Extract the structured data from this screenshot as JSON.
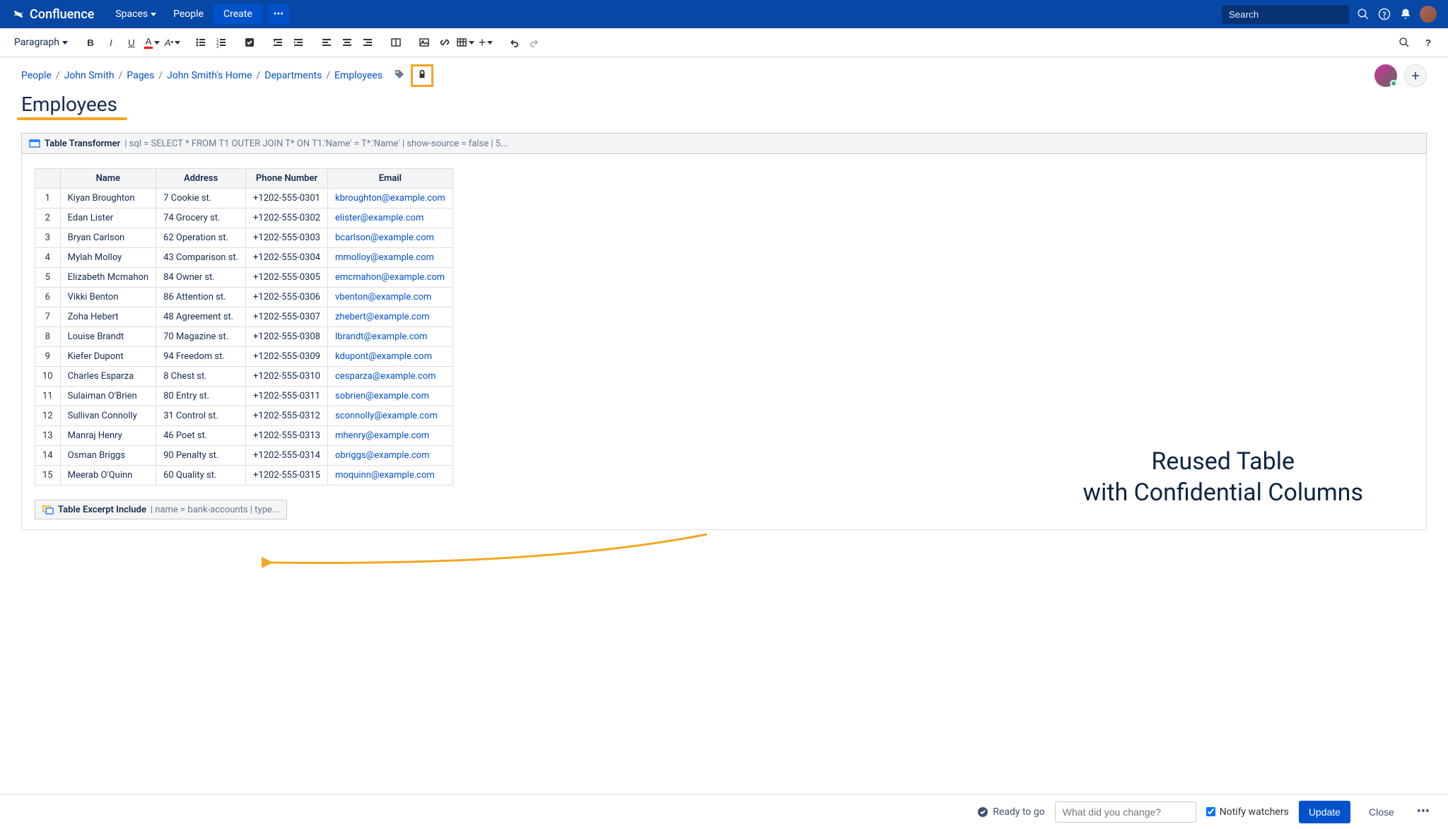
{
  "nav": {
    "product": "Confluence",
    "spaces": "Spaces",
    "people": "People",
    "create": "Create",
    "search_placeholder": "Search"
  },
  "toolbar": {
    "paragraph": "Paragraph"
  },
  "breadcrumb": [
    "People",
    "John Smith",
    "Pages",
    "John Smith's Home",
    "Departments",
    "Employees"
  ],
  "page_title": "Employees",
  "macro": {
    "name": "Table Transformer",
    "params": "sql = SELECT * FROM T1 OUTER JOIN T* ON T1.'Name' = T*.'Name' | show-source = false | 5..."
  },
  "table": {
    "columns": [
      "Name",
      "Address",
      "Phone Number",
      "Email"
    ],
    "rows": [
      {
        "idx": 1,
        "name": "Kiyan Broughton",
        "address": "7 Cookie st.",
        "phone": "+1202-555-0301",
        "email": "kbroughton@example.com"
      },
      {
        "idx": 2,
        "name": "Edan Lister",
        "address": "74 Grocery st.",
        "phone": "+1202-555-0302",
        "email": "elister@example.com"
      },
      {
        "idx": 3,
        "name": "Bryan Carlson",
        "address": "62 Operation st.",
        "phone": "+1202-555-0303",
        "email": "bcarlson@example.com"
      },
      {
        "idx": 4,
        "name": "Mylah Molloy",
        "address": "43 Comparison st.",
        "phone": "+1202-555-0304",
        "email": "mmolloy@example.com"
      },
      {
        "idx": 5,
        "name": "Elizabeth Mcmahon",
        "address": "84 Owner st.",
        "phone": "+1202-555-0305",
        "email": "emcmahon@example.com"
      },
      {
        "idx": 6,
        "name": "Vikki Benton",
        "address": "86 Attention st.",
        "phone": "+1202-555-0306",
        "email": "vbenton@example.com"
      },
      {
        "idx": 7,
        "name": "Zoha Hebert",
        "address": "48 Agreement st.",
        "phone": "+1202-555-0307",
        "email": "zhebert@example.com"
      },
      {
        "idx": 8,
        "name": "Louise Brandt",
        "address": "70 Magazine st.",
        "phone": "+1202-555-0308",
        "email": "lbrandt@example.com"
      },
      {
        "idx": 9,
        "name": "Kiefer Dupont",
        "address": "94 Freedom st.",
        "phone": "+1202-555-0309",
        "email": "kdupont@example.com"
      },
      {
        "idx": 10,
        "name": "Charles Esparza",
        "address": "8 Chest st.",
        "phone": "+1202-555-0310",
        "email": "cesparza@example.com"
      },
      {
        "idx": 11,
        "name": "Sulaiman O'Brien",
        "address": "80 Entry st.",
        "phone": "+1202-555-0311",
        "email": "sobrien@example.com"
      },
      {
        "idx": 12,
        "name": "Sullivan Connolly",
        "address": "31 Control st.",
        "phone": "+1202-555-0312",
        "email": "sconnolly@example.com"
      },
      {
        "idx": 13,
        "name": "Manraj Henry",
        "address": "46 Poet st.",
        "phone": "+1202-555-0313",
        "email": "mhenry@example.com"
      },
      {
        "idx": 14,
        "name": "Osman Briggs",
        "address": "90 Penalty st.",
        "phone": "+1202-555-0314",
        "email": "obriggs@example.com"
      },
      {
        "idx": 15,
        "name": "Meerab O'Quinn",
        "address": "60 Quality st.",
        "phone": "+1202-555-0315",
        "email": "moquinn@example.com"
      }
    ]
  },
  "excerpt": {
    "name": "Table Excerpt Include",
    "params": "name = bank-accounts | type..."
  },
  "annotation": {
    "line1": "Reused Table",
    "line2": "with Confidential Columns"
  },
  "footer": {
    "ready": "Ready to go",
    "change_placeholder": "What did you change?",
    "notify": "Notify watchers",
    "update": "Update",
    "close": "Close"
  }
}
